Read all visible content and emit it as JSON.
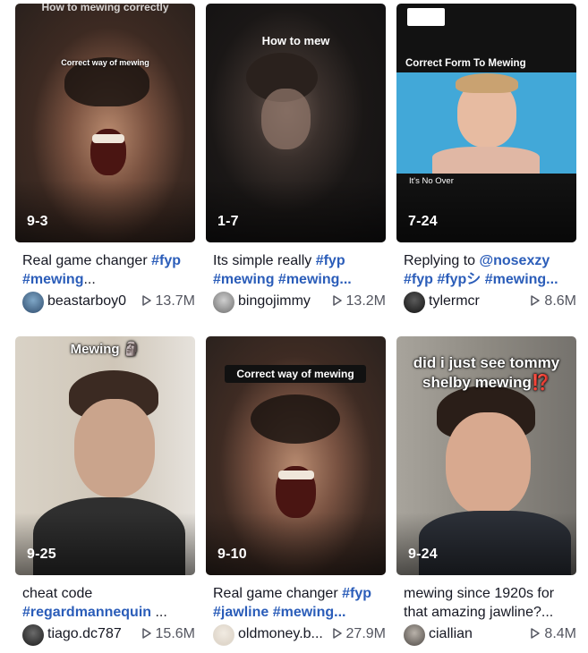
{
  "videos": [
    {
      "badge": "9-3",
      "overlay_top": "How to mewing correctly",
      "overlay_mid": "Correct way of mewing",
      "caption_line1_text": "Real game changer ",
      "caption_line1_tag": "#fyp",
      "caption_line2_tag": "#mewing",
      "caption_line2_rest": "...",
      "author": "beastarboy0",
      "plays": "13.7M"
    },
    {
      "badge": "1-7",
      "overlay_top": "How to mew",
      "caption_line1_text": "Its simple really ",
      "caption_line1_tag": "#fyp",
      "caption_line2_tag": "#mewing",
      "caption_line2_tag2": "#mewing...",
      "author": "bingojimmy",
      "plays": "13.2M"
    },
    {
      "badge": "7-24",
      "overlay_top": "Correct Form To Mewing",
      "overlay_bottom": "It's No Over",
      "caption_line1_text": "Replying to ",
      "caption_line1_tag": "@nosexzy",
      "caption_line2_tag": "#fyp",
      "caption_line2_tag2": "#fypシ",
      "caption_line2_tag3": "#mewing...",
      "author": "tylermcr",
      "plays": "8.6M"
    },
    {
      "badge": "9-25",
      "overlay_top": "Mewing 🗿",
      "caption_line1_text": "cheat code",
      "caption_line2_tag": "#regardmannequin",
      "caption_line2_rest": " ...",
      "author": "tiago.dc787",
      "plays": "15.6M"
    },
    {
      "badge": "9-10",
      "overlay_top": "Correct way of mewing",
      "caption_line1_text": "Real game changer ",
      "caption_line1_tag": "#fyp",
      "caption_line2_tag": "#jawline",
      "caption_line2_tag2": "#mewing...",
      "author": "oldmoney.b...",
      "plays": "27.9M"
    },
    {
      "badge": "9-24",
      "overlay_top": "did i just see tommy",
      "overlay_top2": "shelby mewing⁉️",
      "caption_line1_text": "mewing since 1920s for",
      "caption_line2_text": "that amazing jawline?...",
      "author": "ciallian",
      "plays": "8.4M"
    }
  ],
  "colors": {
    "hashtag": "#2b5db9",
    "text": "#161823",
    "muted": "#545660"
  }
}
